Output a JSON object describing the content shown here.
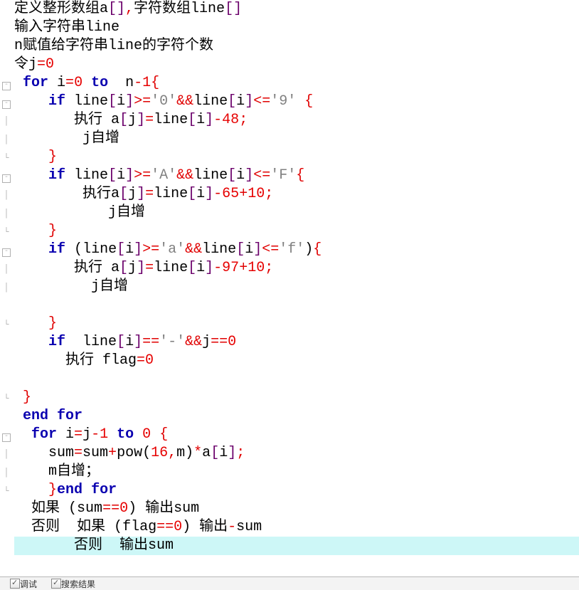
{
  "code": {
    "lines": [
      {
        "gutter": "",
        "class": "",
        "tokens": [
          [
            "cj",
            "定义整形数组"
          ],
          [
            "txt",
            "a"
          ],
          [
            "brk",
            "[]"
          ],
          [
            "op",
            ","
          ],
          [
            "cj",
            "字符数组"
          ],
          [
            "txt",
            "line"
          ],
          [
            "brk",
            "[]"
          ]
        ]
      },
      {
        "gutter": "",
        "class": "",
        "tokens": [
          [
            "cj",
            "输入字符串"
          ],
          [
            "txt",
            "line"
          ]
        ]
      },
      {
        "gutter": "",
        "class": "",
        "tokens": [
          [
            "txt",
            "n"
          ],
          [
            "cj",
            "赋值给字符串"
          ],
          [
            "txt",
            "line"
          ],
          [
            "cj",
            "的字符个数"
          ]
        ]
      },
      {
        "gutter": "",
        "class": "",
        "tokens": [
          [
            "cj",
            "令"
          ],
          [
            "txt",
            "j"
          ],
          [
            "op",
            "="
          ],
          [
            "num",
            "0"
          ]
        ]
      },
      {
        "gutter": "box-",
        "class": "",
        "tokens": [
          [
            "txt",
            " "
          ],
          [
            "kw",
            "for"
          ],
          [
            "txt",
            " i"
          ],
          [
            "op",
            "="
          ],
          [
            "num",
            "0"
          ],
          [
            "txt",
            " "
          ],
          [
            "kw",
            "to"
          ],
          [
            "txt",
            "  n"
          ],
          [
            "op",
            "-"
          ],
          [
            "num",
            "1"
          ],
          [
            "op",
            "{"
          ]
        ]
      },
      {
        "gutter": "box-",
        "class": "",
        "tokens": [
          [
            "txt",
            "    "
          ],
          [
            "kw",
            "if"
          ],
          [
            "txt",
            " line"
          ],
          [
            "brk",
            "["
          ],
          [
            "txt",
            "i"
          ],
          [
            "brk",
            "]"
          ],
          [
            "op",
            ">="
          ],
          [
            "str",
            "'0'"
          ],
          [
            "op",
            "&&"
          ],
          [
            "txt",
            "line"
          ],
          [
            "brk",
            "["
          ],
          [
            "txt",
            "i"
          ],
          [
            "brk",
            "]"
          ],
          [
            "op",
            "<="
          ],
          [
            "str",
            "'9'"
          ],
          [
            "txt",
            " "
          ],
          [
            "op",
            "{"
          ]
        ]
      },
      {
        "gutter": "bar",
        "class": "",
        "tokens": [
          [
            "txt",
            "       "
          ],
          [
            "cj",
            "执行"
          ],
          [
            "txt",
            " a"
          ],
          [
            "brk",
            "["
          ],
          [
            "txt",
            "j"
          ],
          [
            "brk",
            "]"
          ],
          [
            "op",
            "="
          ],
          [
            "txt",
            "line"
          ],
          [
            "brk",
            "["
          ],
          [
            "txt",
            "i"
          ],
          [
            "brk",
            "]"
          ],
          [
            "op",
            "-"
          ],
          [
            "num",
            "48"
          ],
          [
            "op",
            ";"
          ]
        ]
      },
      {
        "gutter": "bar",
        "class": "",
        "tokens": [
          [
            "txt",
            "        j"
          ],
          [
            "cj",
            "自增"
          ]
        ]
      },
      {
        "gutter": "end",
        "class": "",
        "tokens": [
          [
            "txt",
            "    "
          ],
          [
            "op",
            "}"
          ]
        ]
      },
      {
        "gutter": "box-",
        "class": "",
        "tokens": [
          [
            "txt",
            "    "
          ],
          [
            "kw",
            "if"
          ],
          [
            "txt",
            " line"
          ],
          [
            "brk",
            "["
          ],
          [
            "txt",
            "i"
          ],
          [
            "brk",
            "]"
          ],
          [
            "op",
            ">="
          ],
          [
            "str",
            "'A'"
          ],
          [
            "op",
            "&&"
          ],
          [
            "txt",
            "line"
          ],
          [
            "brk",
            "["
          ],
          [
            "txt",
            "i"
          ],
          [
            "brk",
            "]"
          ],
          [
            "op",
            "<="
          ],
          [
            "str",
            "'F'"
          ],
          [
            "op",
            "{"
          ]
        ]
      },
      {
        "gutter": "bar",
        "class": "",
        "tokens": [
          [
            "txt",
            "        "
          ],
          [
            "cj",
            "执行"
          ],
          [
            "txt",
            "a"
          ],
          [
            "brk",
            "["
          ],
          [
            "txt",
            "j"
          ],
          [
            "brk",
            "]"
          ],
          [
            "op",
            "="
          ],
          [
            "txt",
            "line"
          ],
          [
            "brk",
            "["
          ],
          [
            "txt",
            "i"
          ],
          [
            "brk",
            "]"
          ],
          [
            "op",
            "-"
          ],
          [
            "num",
            "65"
          ],
          [
            "op",
            "+"
          ],
          [
            "num",
            "10"
          ],
          [
            "op",
            ";"
          ]
        ]
      },
      {
        "gutter": "bar",
        "class": "",
        "tokens": [
          [
            "txt",
            "           j"
          ],
          [
            "cj",
            "自增"
          ]
        ]
      },
      {
        "gutter": "end",
        "class": "",
        "tokens": [
          [
            "txt",
            "    "
          ],
          [
            "op",
            "}"
          ]
        ]
      },
      {
        "gutter": "box-",
        "class": "",
        "tokens": [
          [
            "txt",
            "    "
          ],
          [
            "kw",
            "if"
          ],
          [
            "txt",
            " "
          ],
          [
            "par",
            "("
          ],
          [
            "txt",
            "line"
          ],
          [
            "brk",
            "["
          ],
          [
            "txt",
            "i"
          ],
          [
            "brk",
            "]"
          ],
          [
            "op",
            ">="
          ],
          [
            "str",
            "'a'"
          ],
          [
            "op",
            "&&"
          ],
          [
            "txt",
            "line"
          ],
          [
            "brk",
            "["
          ],
          [
            "txt",
            "i"
          ],
          [
            "brk",
            "]"
          ],
          [
            "op",
            "<="
          ],
          [
            "str",
            "'f'"
          ],
          [
            "par",
            ")"
          ],
          [
            "op",
            "{"
          ]
        ]
      },
      {
        "gutter": "bar",
        "class": "",
        "tokens": [
          [
            "txt",
            "       "
          ],
          [
            "cj",
            "执行"
          ],
          [
            "txt",
            " a"
          ],
          [
            "brk",
            "["
          ],
          [
            "txt",
            "j"
          ],
          [
            "brk",
            "]"
          ],
          [
            "op",
            "="
          ],
          [
            "txt",
            "line"
          ],
          [
            "brk",
            "["
          ],
          [
            "txt",
            "i"
          ],
          [
            "brk",
            "]"
          ],
          [
            "op",
            "-"
          ],
          [
            "num",
            "97"
          ],
          [
            "op",
            "+"
          ],
          [
            "num",
            "10"
          ],
          [
            "op",
            ";"
          ]
        ]
      },
      {
        "gutter": "bar",
        "class": "",
        "tokens": [
          [
            "txt",
            "         j"
          ],
          [
            "cj",
            "自增"
          ]
        ]
      },
      {
        "gutter": "",
        "class": "",
        "tokens": [
          [
            "txt",
            ""
          ]
        ]
      },
      {
        "gutter": "end",
        "class": "",
        "tokens": [
          [
            "txt",
            "    "
          ],
          [
            "op",
            "}"
          ]
        ]
      },
      {
        "gutter": "",
        "class": "",
        "tokens": [
          [
            "txt",
            "    "
          ],
          [
            "kw",
            "if"
          ],
          [
            "txt",
            "  line"
          ],
          [
            "brk",
            "["
          ],
          [
            "txt",
            "i"
          ],
          [
            "brk",
            "]"
          ],
          [
            "op",
            "=="
          ],
          [
            "str",
            "'-'"
          ],
          [
            "op",
            "&&"
          ],
          [
            "txt",
            "j"
          ],
          [
            "op",
            "=="
          ],
          [
            "num",
            "0"
          ]
        ]
      },
      {
        "gutter": "",
        "class": "",
        "tokens": [
          [
            "txt",
            "      "
          ],
          [
            "cj",
            "执行"
          ],
          [
            "txt",
            " flag"
          ],
          [
            "op",
            "="
          ],
          [
            "num",
            "0"
          ]
        ]
      },
      {
        "gutter": "",
        "class": "",
        "tokens": [
          [
            "txt",
            ""
          ]
        ]
      },
      {
        "gutter": "end",
        "class": "",
        "tokens": [
          [
            "txt",
            " "
          ],
          [
            "op",
            "}"
          ]
        ]
      },
      {
        "gutter": "",
        "class": "",
        "tokens": [
          [
            "txt",
            " "
          ],
          [
            "kw",
            "end"
          ],
          [
            "txt",
            " "
          ],
          [
            "kw",
            "for"
          ]
        ]
      },
      {
        "gutter": "box-",
        "class": "",
        "tokens": [
          [
            "txt",
            "  "
          ],
          [
            "kw",
            "for"
          ],
          [
            "txt",
            " i"
          ],
          [
            "op",
            "="
          ],
          [
            "txt",
            "j"
          ],
          [
            "op",
            "-"
          ],
          [
            "num",
            "1"
          ],
          [
            "txt",
            " "
          ],
          [
            "kw",
            "to"
          ],
          [
            "txt",
            " "
          ],
          [
            "num",
            "0"
          ],
          [
            "txt",
            " "
          ],
          [
            "op",
            "{"
          ]
        ]
      },
      {
        "gutter": "bar",
        "class": "",
        "tokens": [
          [
            "txt",
            "    sum"
          ],
          [
            "op",
            "="
          ],
          [
            "txt",
            "sum"
          ],
          [
            "op",
            "+"
          ],
          [
            "txt",
            "pow"
          ],
          [
            "par",
            "("
          ],
          [
            "num",
            "16"
          ],
          [
            "op",
            ","
          ],
          [
            "txt",
            "m"
          ],
          [
            "par",
            ")"
          ],
          [
            "op",
            "*"
          ],
          [
            "txt",
            "a"
          ],
          [
            "brk",
            "["
          ],
          [
            "txt",
            "i"
          ],
          [
            "brk",
            "]"
          ],
          [
            "op",
            ";"
          ]
        ]
      },
      {
        "gutter": "bar",
        "class": "",
        "tokens": [
          [
            "txt",
            "    m"
          ],
          [
            "cj",
            "自增；"
          ]
        ]
      },
      {
        "gutter": "end",
        "class": "",
        "tokens": [
          [
            "txt",
            "    "
          ],
          [
            "op",
            "}"
          ],
          [
            "kw",
            "end"
          ],
          [
            "txt",
            " "
          ],
          [
            "kw",
            "for"
          ]
        ]
      },
      {
        "gutter": "",
        "class": "",
        "tokens": [
          [
            "txt",
            "  "
          ],
          [
            "cj",
            "如果"
          ],
          [
            "txt",
            " "
          ],
          [
            "par",
            "("
          ],
          [
            "txt",
            "sum"
          ],
          [
            "op",
            "=="
          ],
          [
            "num",
            "0"
          ],
          [
            "par",
            ")"
          ],
          [
            "txt",
            " "
          ],
          [
            "cj",
            "输出"
          ],
          [
            "txt",
            "sum"
          ]
        ]
      },
      {
        "gutter": "",
        "class": "",
        "tokens": [
          [
            "txt",
            "  "
          ],
          [
            "cj",
            "否则"
          ],
          [
            "txt",
            "  "
          ],
          [
            "cj",
            "如果"
          ],
          [
            "txt",
            " "
          ],
          [
            "par",
            "("
          ],
          [
            "txt",
            "flag"
          ],
          [
            "op",
            "=="
          ],
          [
            "num",
            "0"
          ],
          [
            "par",
            ")"
          ],
          [
            "txt",
            " "
          ],
          [
            "cj",
            "输出"
          ],
          [
            "op",
            "-"
          ],
          [
            "txt",
            "sum"
          ]
        ]
      },
      {
        "gutter": "",
        "class": "hl",
        "tokens": [
          [
            "txt",
            "       "
          ],
          [
            "cj",
            "否则"
          ],
          [
            "txt",
            "  "
          ],
          [
            "cj",
            "输出"
          ],
          [
            "txt",
            "sum"
          ]
        ]
      }
    ]
  },
  "statusbar": {
    "item1": "调试",
    "item2": "搜索结果"
  }
}
